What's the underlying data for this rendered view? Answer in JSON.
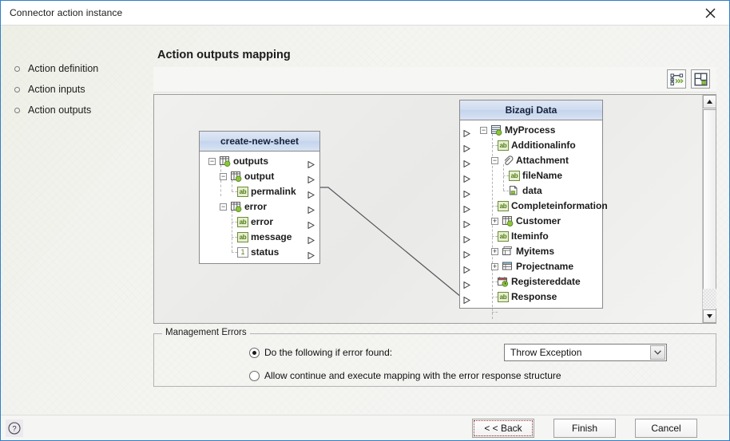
{
  "window": {
    "title": "Connector action instance",
    "close_icon": "close-icon"
  },
  "sidebar": {
    "items": [
      {
        "label": "Action definition"
      },
      {
        "label": "Action inputs"
      },
      {
        "label": "Action outputs"
      }
    ]
  },
  "main": {
    "page_title": "Action outputs mapping",
    "toolbar": {
      "buttons": [
        {
          "name": "auto-map-button",
          "icon": "mapping-icon",
          "tooltip": "Auto map"
        },
        {
          "name": "layout-button",
          "icon": "layout-grid-icon",
          "tooltip": "Layout"
        }
      ]
    }
  },
  "source_tree": {
    "title": "create-new-sheet",
    "nodes": [
      {
        "label": "outputs",
        "type": "collection",
        "icon": "collection-icon",
        "depth": 0,
        "expander": "minus",
        "port": true
      },
      {
        "label": "output",
        "type": "collection",
        "icon": "collection-icon",
        "depth": 1,
        "expander": "minus",
        "port": true
      },
      {
        "label": "permalink",
        "type": "string",
        "icon": "ab-icon",
        "depth": 2,
        "expander": "none",
        "port": true
      },
      {
        "label": "error",
        "type": "collection",
        "icon": "collection-icon",
        "depth": 1,
        "expander": "minus",
        "port": true
      },
      {
        "label": "error",
        "type": "string",
        "icon": "ab-icon",
        "depth": 2,
        "expander": "none",
        "port": true
      },
      {
        "label": "message",
        "type": "string",
        "icon": "ab-icon",
        "depth": 2,
        "expander": "none",
        "port": true
      },
      {
        "label": "status",
        "type": "number",
        "icon": "number-icon",
        "depth": 2,
        "expander": "none",
        "port": true
      }
    ]
  },
  "target_tree": {
    "title": "Bizagi Data",
    "nodes": [
      {
        "label": "MyProcess",
        "type": "entity",
        "icon": "process-icon",
        "depth": 0,
        "expander": "minus",
        "port": true
      },
      {
        "label": "Additionalinfo",
        "type": "string",
        "icon": "ab-icon",
        "depth": 1,
        "expander": "none",
        "port": true
      },
      {
        "label": "Attachment",
        "type": "file",
        "icon": "paperclip-icon",
        "depth": 1,
        "expander": "minus",
        "port": true
      },
      {
        "label": "fileName",
        "type": "string",
        "icon": "ab-icon",
        "depth": 2,
        "expander": "none",
        "port": true
      },
      {
        "label": "data",
        "type": "binary",
        "icon": "document-icon",
        "depth": 2,
        "expander": "none",
        "port": true
      },
      {
        "label": "Completeinformation",
        "type": "string",
        "icon": "ab-icon",
        "depth": 1,
        "expander": "none",
        "port": true
      },
      {
        "label": "Customer",
        "type": "collection",
        "icon": "collection-icon",
        "depth": 1,
        "expander": "plus",
        "port": true
      },
      {
        "label": "Iteminfo",
        "type": "string",
        "icon": "ab-icon",
        "depth": 1,
        "expander": "none",
        "port": true
      },
      {
        "label": "Myitems",
        "type": "table",
        "icon": "table-icon",
        "depth": 1,
        "expander": "plus",
        "port": true
      },
      {
        "label": "Projectname",
        "type": "list",
        "icon": "list-icon",
        "depth": 1,
        "expander": "plus",
        "port": true
      },
      {
        "label": "Registereddate",
        "type": "date",
        "icon": "calendar-icon",
        "depth": 1,
        "expander": "none",
        "port": true
      },
      {
        "label": "Response",
        "type": "string",
        "icon": "ab-icon",
        "depth": 1,
        "expander": "none",
        "port": true
      }
    ]
  },
  "mapping": {
    "connections": [
      {
        "from": "permalink",
        "to": "Response"
      }
    ]
  },
  "error_management": {
    "legend": "Management Errors",
    "option_throw": {
      "label": "Do the following if error found:",
      "selected": true
    },
    "option_continue": {
      "label": "Allow continue and execute mapping with the error response structure",
      "selected": false
    },
    "dropdown": {
      "value": "Throw Exception",
      "options": [
        "Throw Exception"
      ]
    }
  },
  "footer": {
    "help_label": "?",
    "back_label": "< < Back",
    "finish_label": "Finish",
    "cancel_label": "Cancel"
  },
  "scrollbar": {
    "up_arrow": "▲",
    "down_arrow": "▼"
  },
  "colors": {
    "accent": "#2f80c8",
    "header_blue": "#cfdcf0",
    "string_icon_green": "#6f8b3a"
  }
}
